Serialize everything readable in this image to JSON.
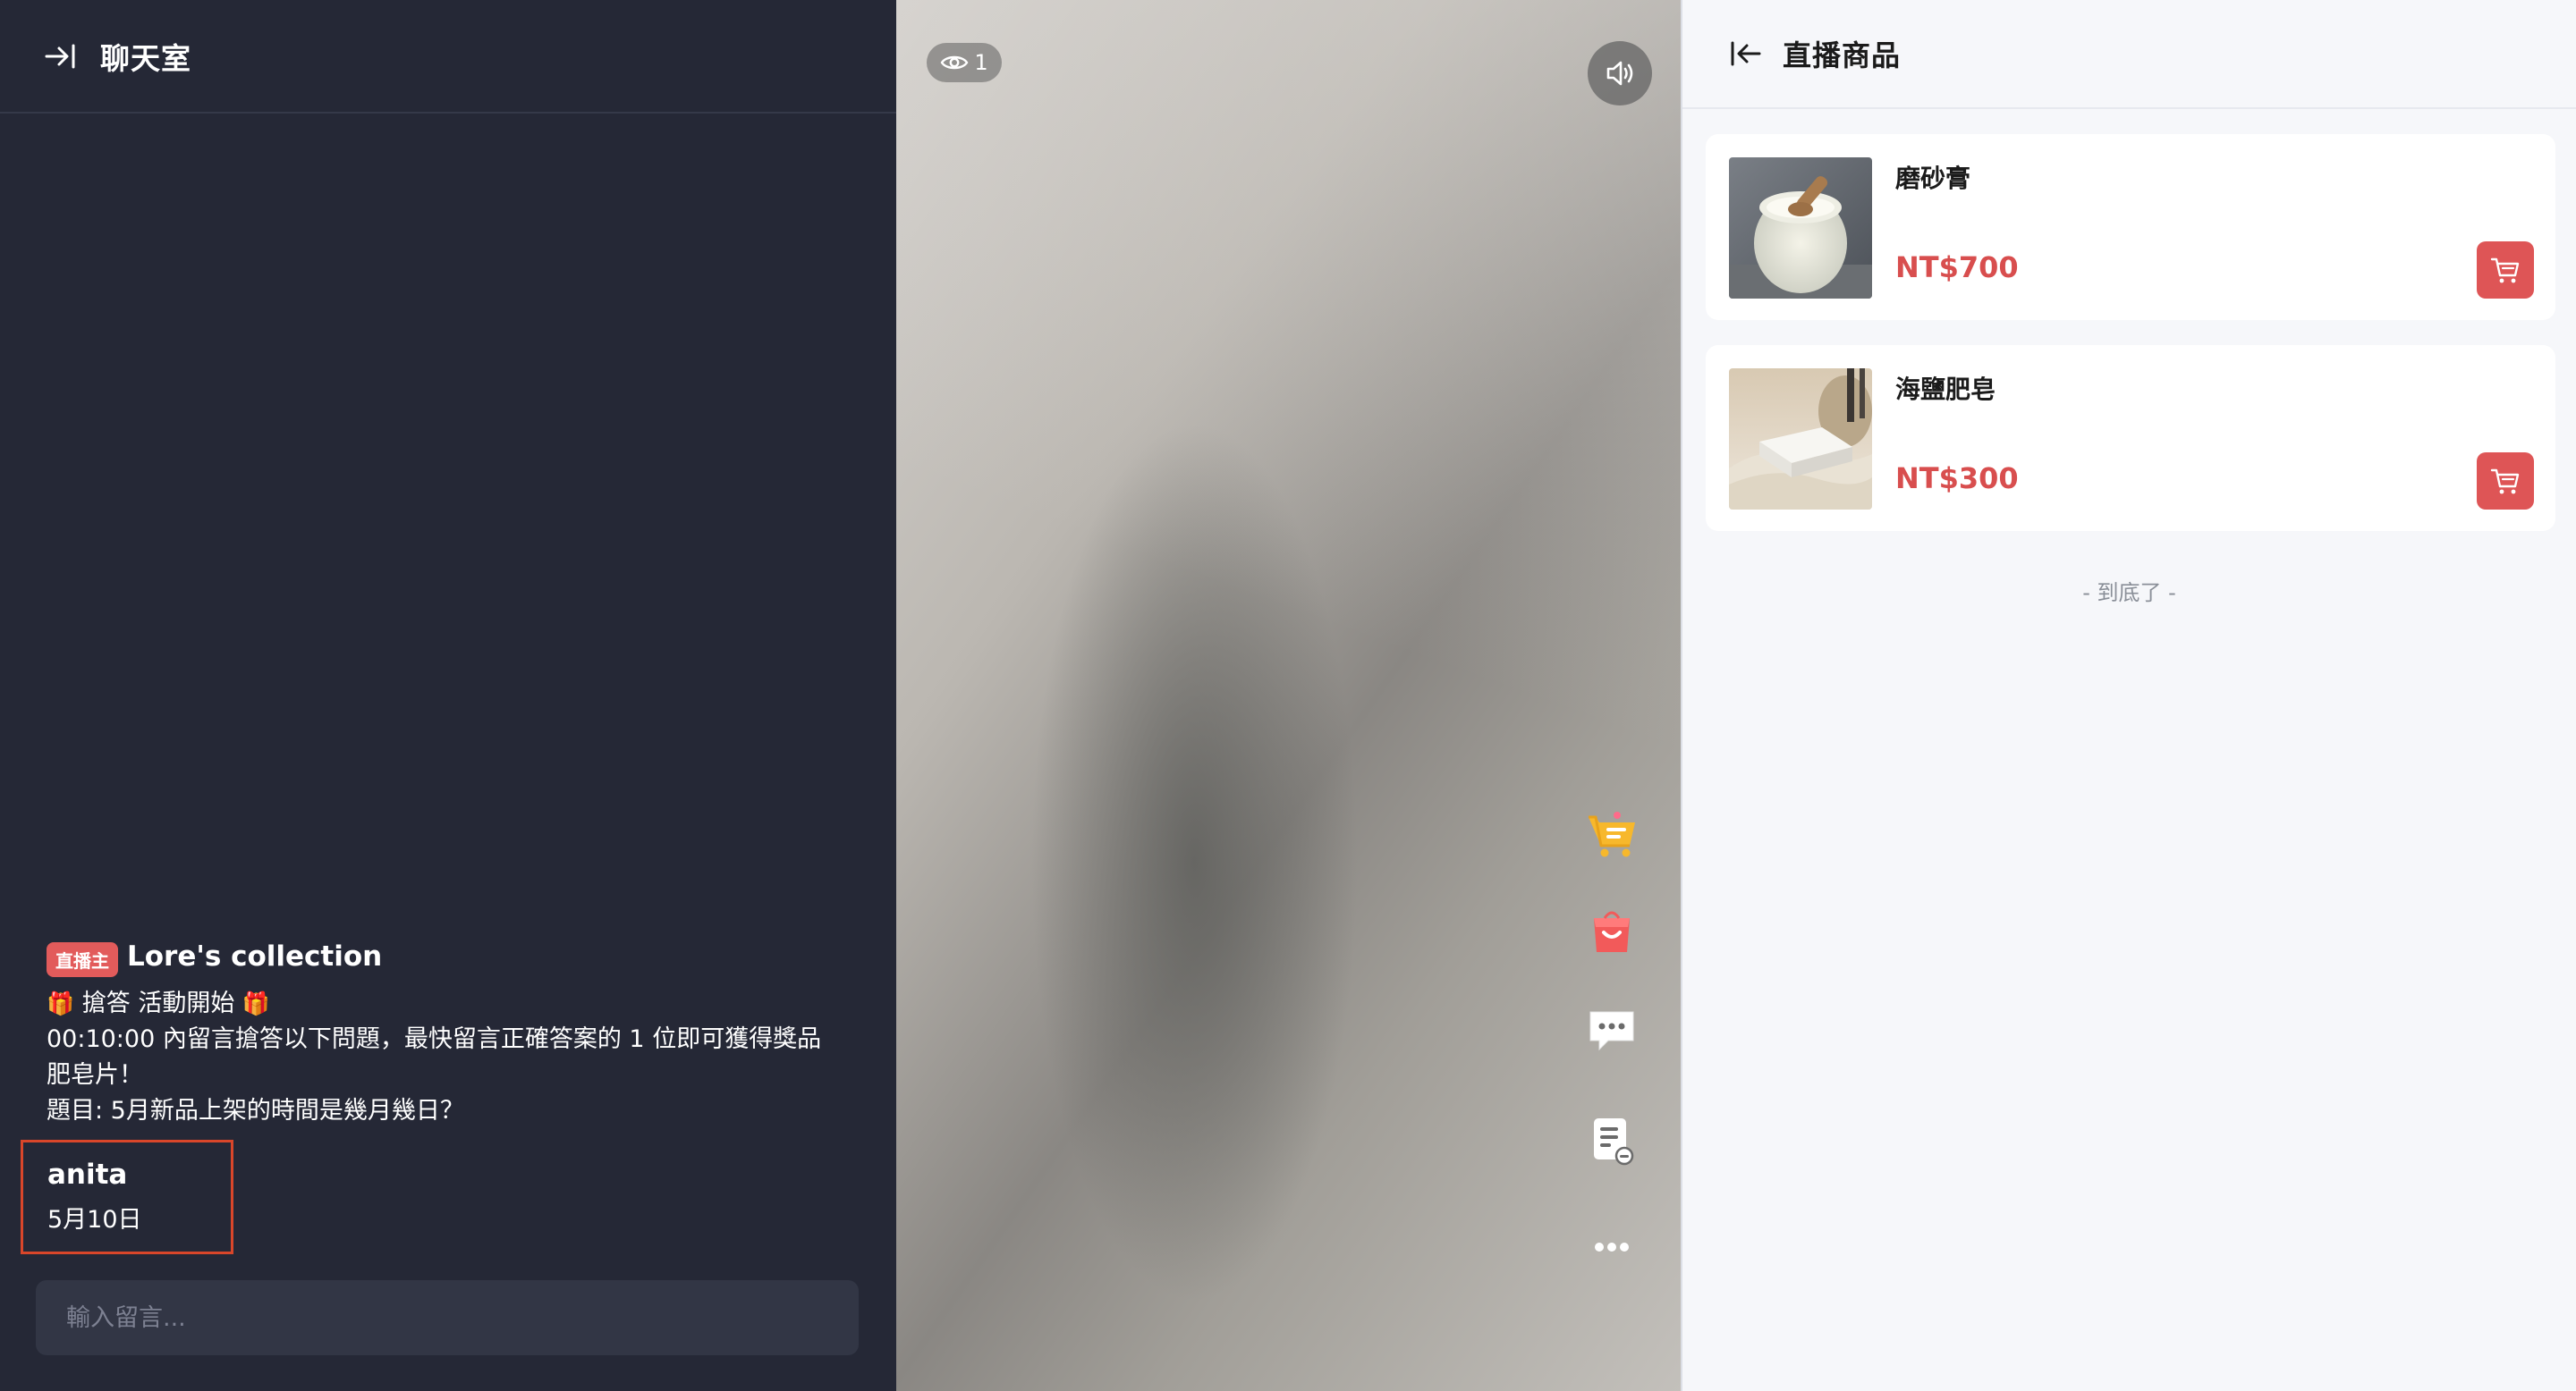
{
  "chat": {
    "title": "聊天室",
    "host_message": {
      "badge": "直播主",
      "name": "Lore's collection",
      "gift_left": "🎁",
      "headline": "搶答 活動開始",
      "gift_right": "🎁",
      "line1": "00:10:00 內留言搶答以下問題，最快留言正確答案的 1 位即可獲得獎品",
      "line2": "肥皂片！",
      "line3": "題目: 5月新品上架的時間是幾月幾日？"
    },
    "user_message": {
      "name": "anita",
      "text": "5月10日"
    },
    "input_placeholder": "輸入留言..."
  },
  "video": {
    "viewer_count": "1"
  },
  "products": {
    "title": "直播商品",
    "items": [
      {
        "name": "磨砂膏",
        "price": "NT$700"
      },
      {
        "name": "海鹽肥皂",
        "price": "NT$300"
      }
    ],
    "end_note": "- 到底了 -"
  },
  "colors": {
    "chat_bg": "#252836",
    "accent_red": "#de5556",
    "highlight_border": "#d9462a",
    "products_bg": "#f6f7fa"
  },
  "icons": {
    "chat_collapse": "arrow-right-to-bar-icon",
    "products_back": "arrow-left-from-bar-icon",
    "viewers": "eye-icon",
    "sound": "speaker-icon",
    "side": [
      "cart-icon",
      "shopping-bag-icon",
      "chat-bubble-icon",
      "note-list-icon",
      "more-icon"
    ]
  }
}
